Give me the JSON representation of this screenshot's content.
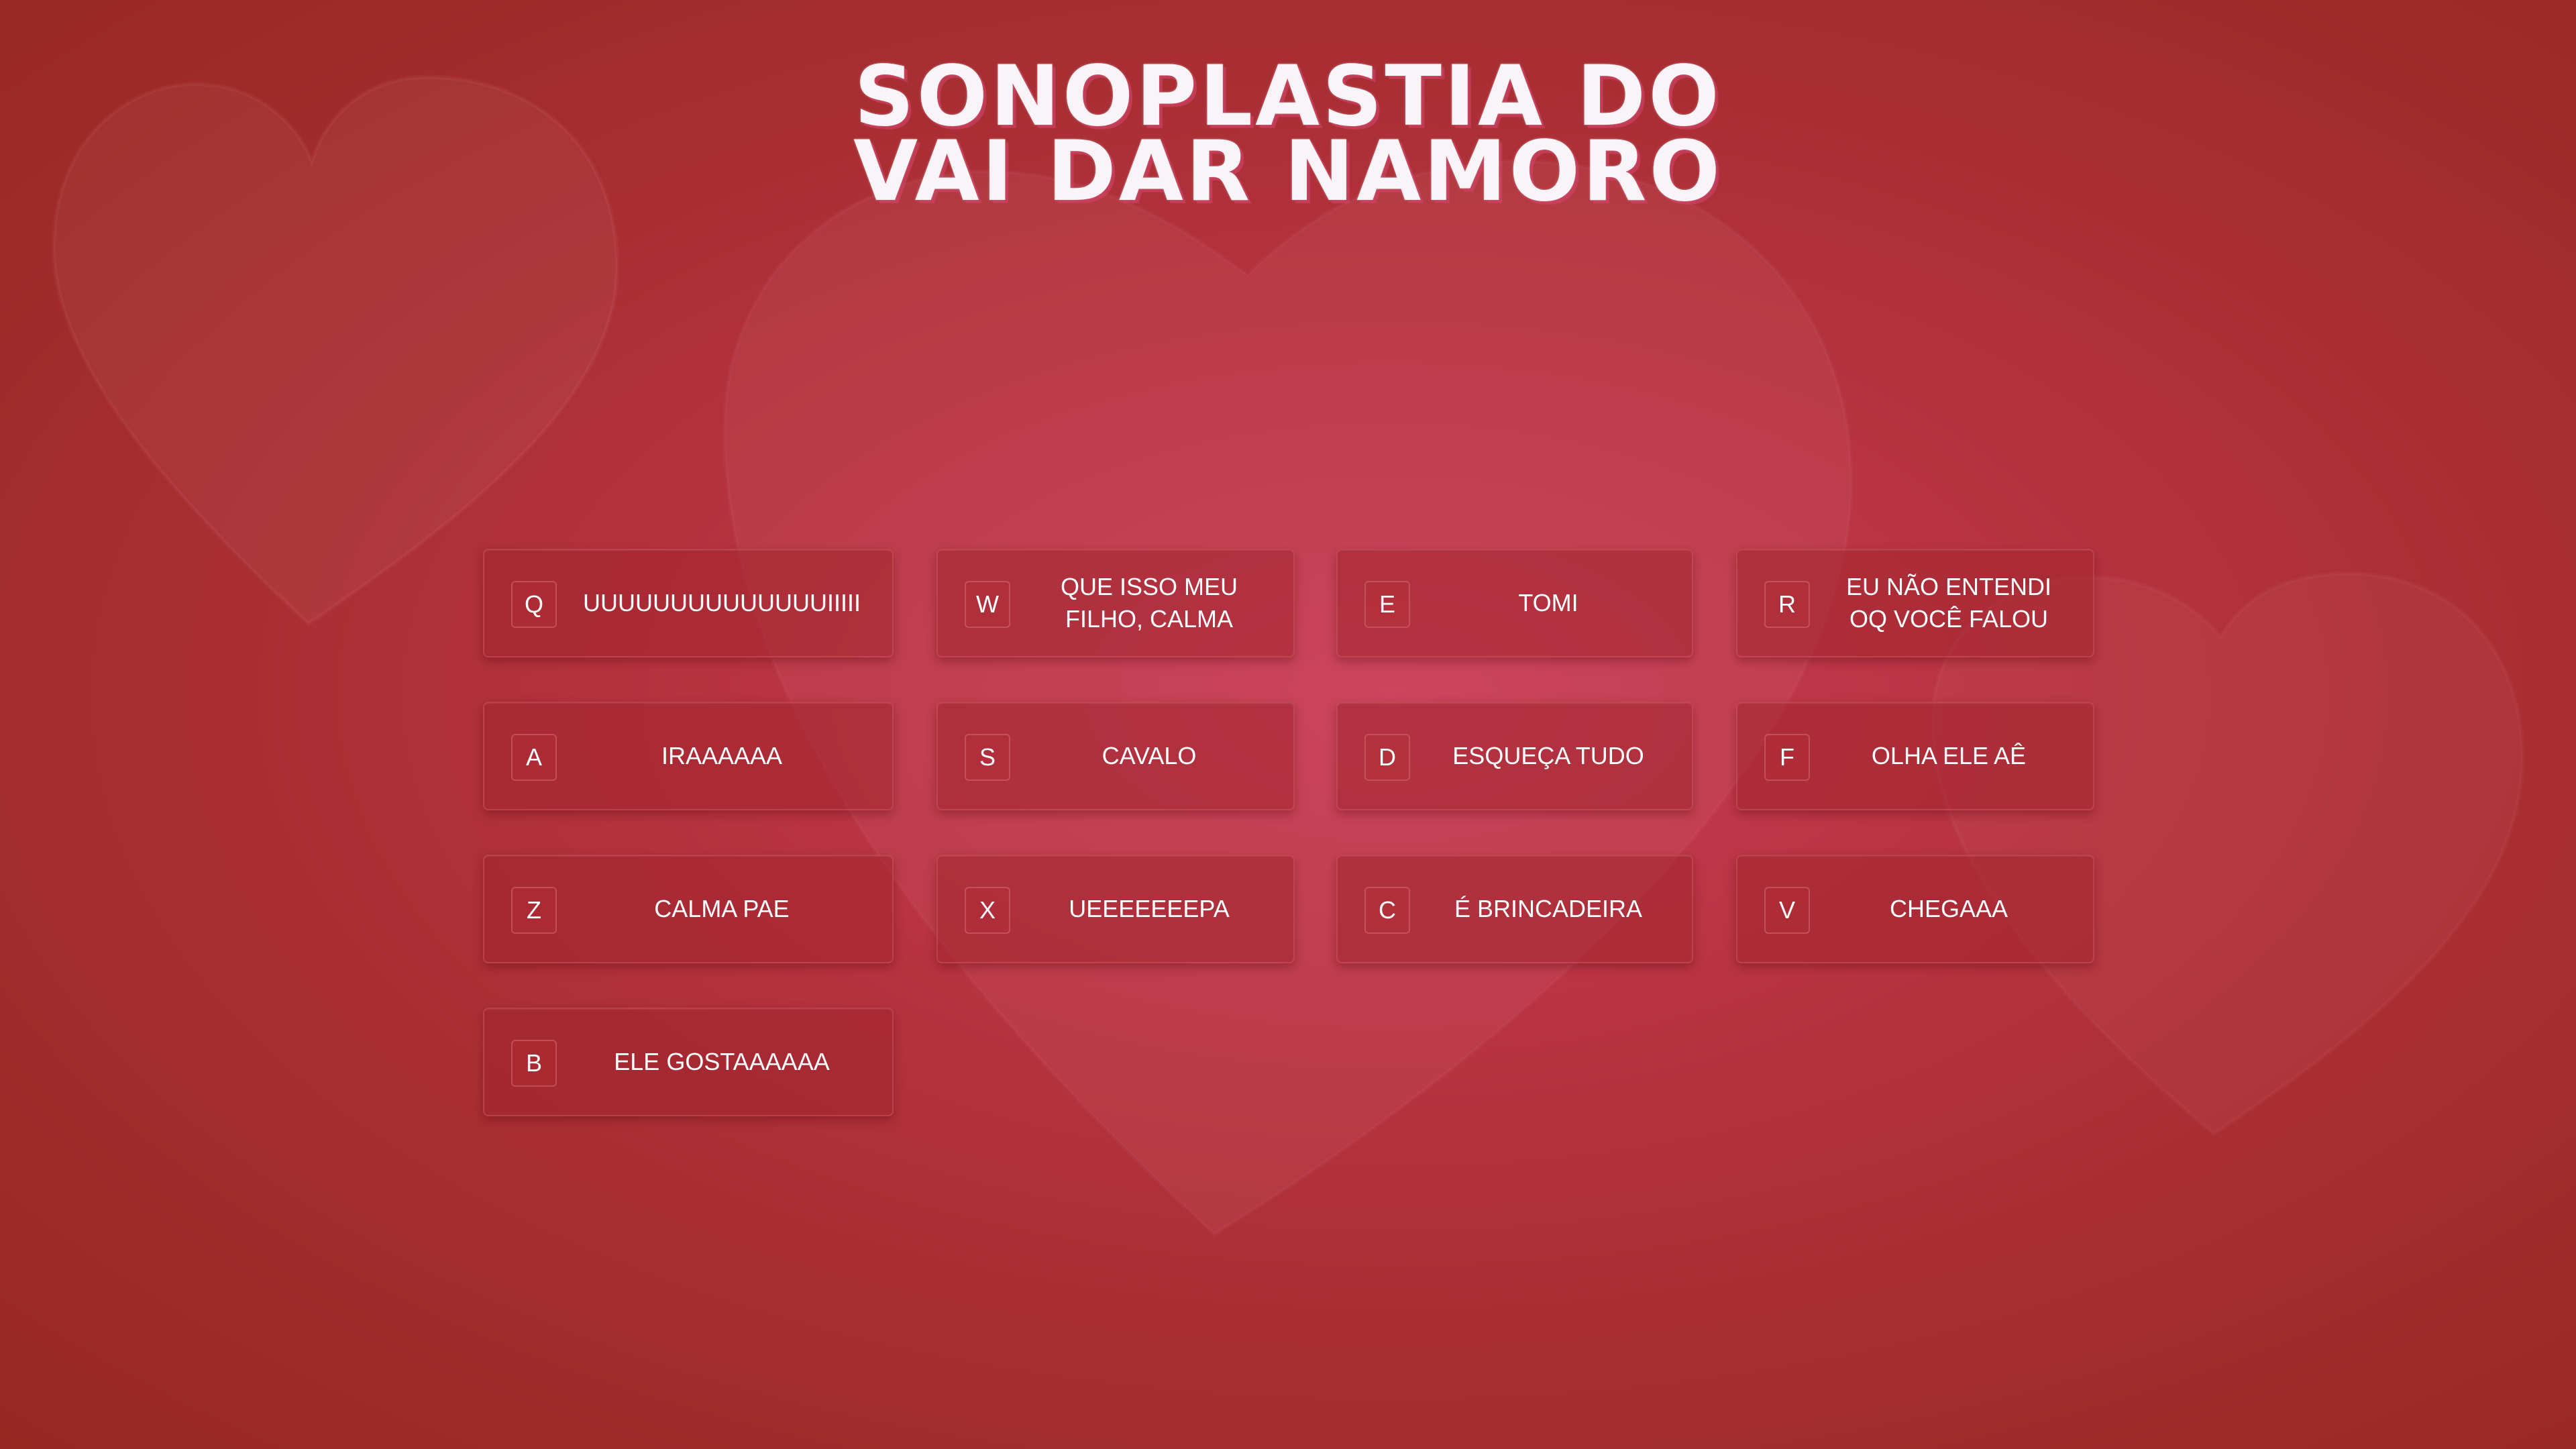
{
  "title": {
    "line1": "SONOPLASTIA DO",
    "line2": "VAI DAR NAMORO"
  },
  "colors": {
    "background": "#b93443",
    "pad": "#a0242e",
    "text": "#ffffff",
    "title_shadow": "#d6466e"
  },
  "background_icon": "heart-icon",
  "pads": [
    {
      "key": "Q",
      "label": "UUUUUUUUUUUUUUIIIII"
    },
    {
      "key": "W",
      "label": "QUE ISSO MEU FILHO, CALMA"
    },
    {
      "key": "E",
      "label": "TOMI"
    },
    {
      "key": "R",
      "label": "EU NÃO ENTENDI OQ VOCÊ FALOU"
    },
    {
      "key": "A",
      "label": "IRAAAAAA"
    },
    {
      "key": "S",
      "label": "CAVALO"
    },
    {
      "key": "D",
      "label": "ESQUEÇA TUDO"
    },
    {
      "key": "F",
      "label": "OLHA ELE AÊ"
    },
    {
      "key": "Z",
      "label": "CALMA PAE"
    },
    {
      "key": "X",
      "label": "UEEEEEEEPA"
    },
    {
      "key": "C",
      "label": "É BRINCADEIRA"
    },
    {
      "key": "V",
      "label": "CHEGAAA"
    },
    {
      "key": "B",
      "label": "ELE GOSTAAAAAA"
    }
  ]
}
